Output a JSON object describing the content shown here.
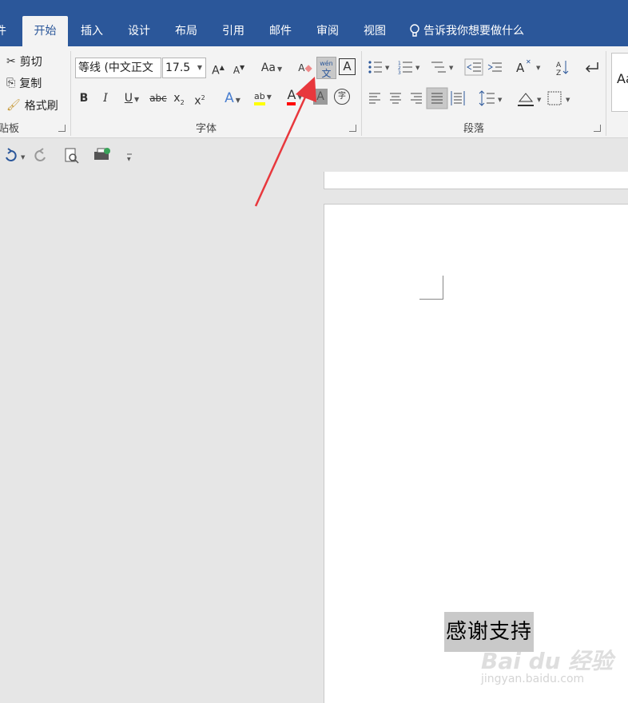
{
  "tabs": [
    {
      "label": "开始",
      "active": true
    },
    {
      "label": "插入"
    },
    {
      "label": "设计"
    },
    {
      "label": "布局"
    },
    {
      "label": "引用"
    },
    {
      "label": "邮件"
    },
    {
      "label": "审阅"
    },
    {
      "label": "视图"
    }
  ],
  "tell_me": "告诉我你想要做什么",
  "clipboard": {
    "cut": "剪切",
    "copy": "复制",
    "format_painter": "格式刷",
    "group": "贴板"
  },
  "font": {
    "name": "等线 (中文正文",
    "size": "17.5",
    "group": "字体",
    "grow": "A",
    "shrink": "A",
    "case": "Aa",
    "clear": "A",
    "phonetic_top": "wén",
    "phonetic_char": "文",
    "border_char": "A",
    "bold": "B",
    "italic": "I",
    "underline": "U",
    "strike": "abc",
    "sub": "x",
    "sup": "x",
    "effects": "A",
    "highlight": "ab",
    "color": "A",
    "shade": "A",
    "enclose": "字"
  },
  "paragraph": {
    "group": "段落"
  },
  "styles": {
    "preview": "Aa"
  },
  "document": {
    "selected_text": "感谢支持"
  },
  "watermark": {
    "brand": "Bai du 经验",
    "url": "jingyan.baidu.com"
  },
  "colors": {
    "accent": "#2b579a",
    "arrow": "#e8383d",
    "highlight": "#ffff00",
    "font_color": "#ff0000"
  }
}
